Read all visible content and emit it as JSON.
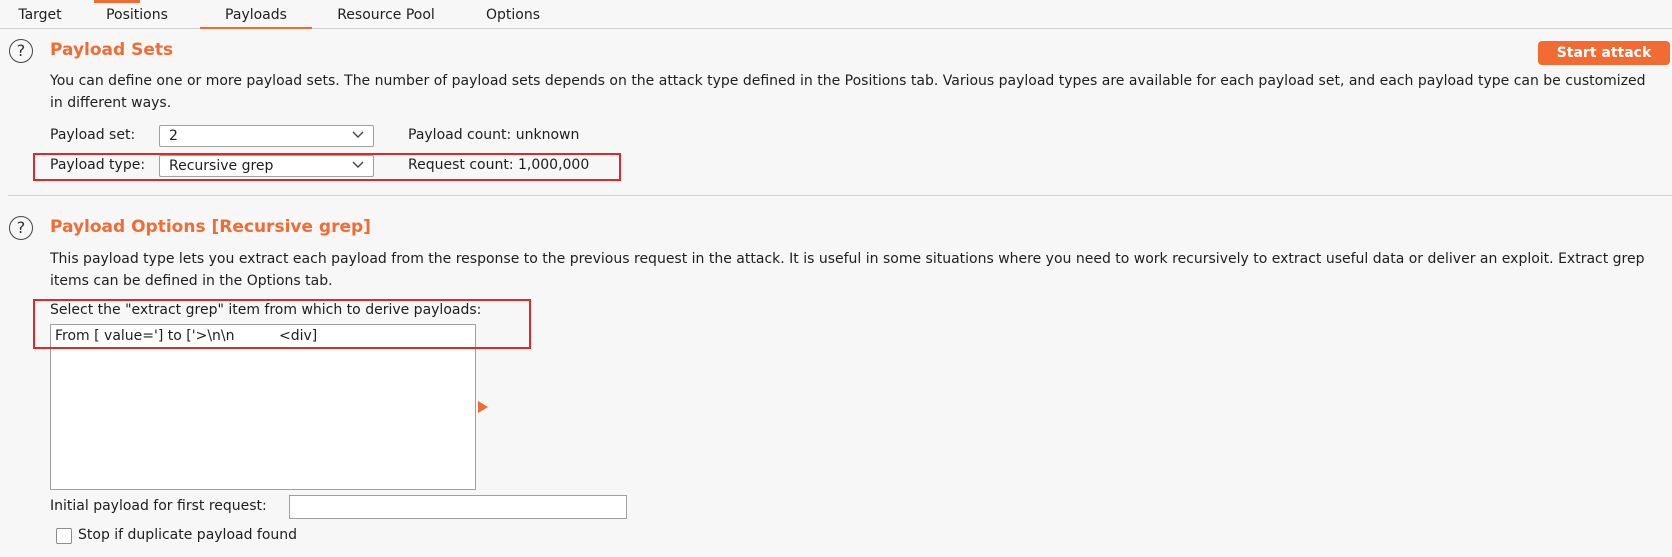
{
  "tabs": [
    {
      "label": "Target"
    },
    {
      "label": "Positions"
    },
    {
      "label": "Payloads",
      "active": true
    },
    {
      "label": "Resource Pool"
    },
    {
      "label": "Options"
    }
  ],
  "payload_sets": {
    "title": "Payload Sets",
    "description": "You can define one or more payload sets. The number of payload sets depends on the attack type defined in the Positions tab. Various payload types are available for each payload set, and each payload type can be customized in different ways.",
    "start_attack_label": "Start attack",
    "payload_set_label": "Payload set:",
    "payload_set_value": "2",
    "payload_type_label": "Payload type:",
    "payload_type_value": "Recursive grep",
    "payload_count_label": "Payload count:",
    "payload_count_value": "unknown",
    "request_count_label": "Request count:",
    "request_count_value": "1,000,000"
  },
  "payload_options": {
    "title": "Payload Options [Recursive grep]",
    "description": "This payload type lets you extract each payload from the response to the previous request in the attack. It is useful in some situations where you need to work recursively to extract useful data or deliver an exploit. Extract grep items can be defined in the Options tab.",
    "select_label": "Select the \"extract grep\" item from which to derive payloads:",
    "items": [
      "From [ value='] to ['>\\n\\n          <div]"
    ],
    "initial_payload_label": "Initial payload for first request:",
    "initial_payload_value": "",
    "stop_duplicate_label": "Stop if duplicate payload found",
    "stop_duplicate_checked": false
  },
  "colors": {
    "accent": "#f26b32",
    "highlight": "#e0282c"
  },
  "icons": [
    "help-icon",
    "chevron-down-icon",
    "arrow-right-icon"
  ]
}
